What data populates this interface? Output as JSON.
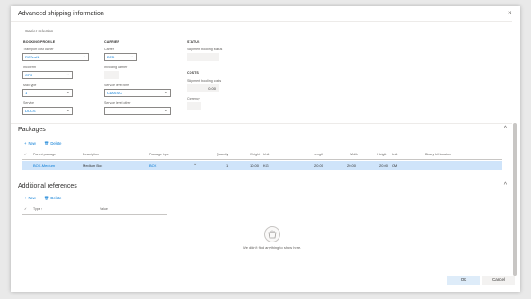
{
  "dialog": {
    "title": "Advanced shipping information",
    "close_label": "×"
  },
  "carrier_selection_link": "Carrier selection",
  "booking_profile": {
    "heading": "BOOKING PROFILE",
    "transport_cost_owner": {
      "label": "Transport cost owner",
      "value": "RCTest1"
    },
    "incoterm": {
      "label": "Incoterm",
      "value": "CFR"
    },
    "mail_type": {
      "label": "Mail type",
      "value": "1"
    },
    "service": {
      "label": "Service",
      "value": "DOCS"
    }
  },
  "carrier": {
    "heading": "CARRIER",
    "carrier": {
      "label": "Carrier",
      "value": "DPD"
    },
    "invoicing_carrier": {
      "label": "Invoicing carrier",
      "value": ""
    },
    "service_level_time": {
      "label": "Service level time",
      "value": "CLASSIC"
    },
    "service_level_other": {
      "label": "Service level other",
      "value": ""
    }
  },
  "status": {
    "heading": "STATUS",
    "shipment_booking_status": {
      "label": "Shipment booking status",
      "value": ""
    }
  },
  "costs": {
    "heading": "COSTS",
    "shipment_booking_costs": {
      "label": "Shipment booking costs",
      "value": "0.00"
    },
    "currency": {
      "label": "Currency",
      "value": ""
    }
  },
  "packages": {
    "title": "Packages",
    "toolbar": {
      "new": "New",
      "delete": "Delete"
    },
    "columns": [
      "Parent package",
      "Description",
      "Package type",
      "Quantity",
      "Weight",
      "Unit",
      "Length",
      "Width",
      "Height",
      "Unit",
      "Binary bill location"
    ],
    "rows": [
      {
        "parent_package": "BOX-Medium",
        "description": "Medium Box",
        "package_type": "BOX",
        "quantity": "1",
        "weight": "10.00",
        "weight_unit": "KG",
        "length": "20.00",
        "width": "20.00",
        "height": "20.00",
        "size_unit": "CM",
        "binary_bill_location": ""
      }
    ]
  },
  "additional_references": {
    "title": "Additional references",
    "toolbar": {
      "new": "New",
      "delete": "Delete"
    },
    "columns": [
      "Type ↑",
      "Value"
    ],
    "empty_message": "We didn't find anything to show here."
  },
  "footer": {
    "ok": "OK",
    "cancel": "Cancel"
  },
  "colors": {
    "accent": "#0078d4",
    "selected_row": "#cfe4fa"
  }
}
